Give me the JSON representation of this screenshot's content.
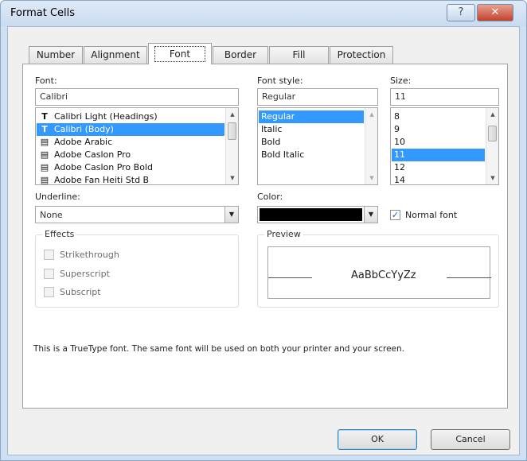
{
  "window": {
    "title": "Format Cells",
    "help_glyph": "?",
    "close_glyph": "✕"
  },
  "tabs": [
    {
      "label": "Number"
    },
    {
      "label": "Alignment"
    },
    {
      "label": "Font"
    },
    {
      "label": "Border"
    },
    {
      "label": "Fill"
    },
    {
      "label": "Protection"
    }
  ],
  "font": {
    "label": "Font:",
    "value": "Calibri",
    "items": [
      {
        "icon": "truetype-icon",
        "glyph": "T",
        "label": "Calibri Light (Headings)"
      },
      {
        "icon": "truetype-icon",
        "glyph": "T",
        "label": "Calibri (Body)",
        "selected": true
      },
      {
        "icon": "printer-font-icon",
        "glyph": "▤",
        "label": "Adobe Arabic"
      },
      {
        "icon": "printer-font-icon",
        "glyph": "▤",
        "label": "Adobe Caslon Pro"
      },
      {
        "icon": "printer-font-icon",
        "glyph": "▤",
        "label": "Adobe Caslon Pro Bold"
      },
      {
        "icon": "printer-font-icon",
        "glyph": "▤",
        "label": "Adobe Fan Heiti Std B"
      }
    ]
  },
  "font_style": {
    "label": "Font style:",
    "value": "Regular",
    "items": [
      {
        "label": "Regular",
        "selected": true
      },
      {
        "label": "Italic"
      },
      {
        "label": "Bold"
      },
      {
        "label": "Bold Italic"
      }
    ]
  },
  "size": {
    "label": "Size:",
    "value": "11",
    "items": [
      {
        "label": "8"
      },
      {
        "label": "9"
      },
      {
        "label": "10"
      },
      {
        "label": "11",
        "selected": true
      },
      {
        "label": "12"
      },
      {
        "label": "14"
      }
    ]
  },
  "underline": {
    "label": "Underline:",
    "value": "None"
  },
  "color": {
    "label": "Color:",
    "swatch": "#000000"
  },
  "normal_font": {
    "label": "Normal font",
    "checked": true
  },
  "effects": {
    "title": "Effects",
    "items": [
      {
        "label": "Strikethrough"
      },
      {
        "label": "Superscript"
      },
      {
        "label": "Subscript"
      }
    ]
  },
  "preview": {
    "title": "Preview",
    "sample": "AaBbCcYyZz"
  },
  "info_text": "This is a TrueType font.  The same font will be used on both your printer and your screen.",
  "buttons": {
    "ok": "OK",
    "cancel": "Cancel"
  },
  "colors": {
    "selection": "#3399ff",
    "title_bar": "#cfe0f2",
    "close": "#c4432c"
  }
}
